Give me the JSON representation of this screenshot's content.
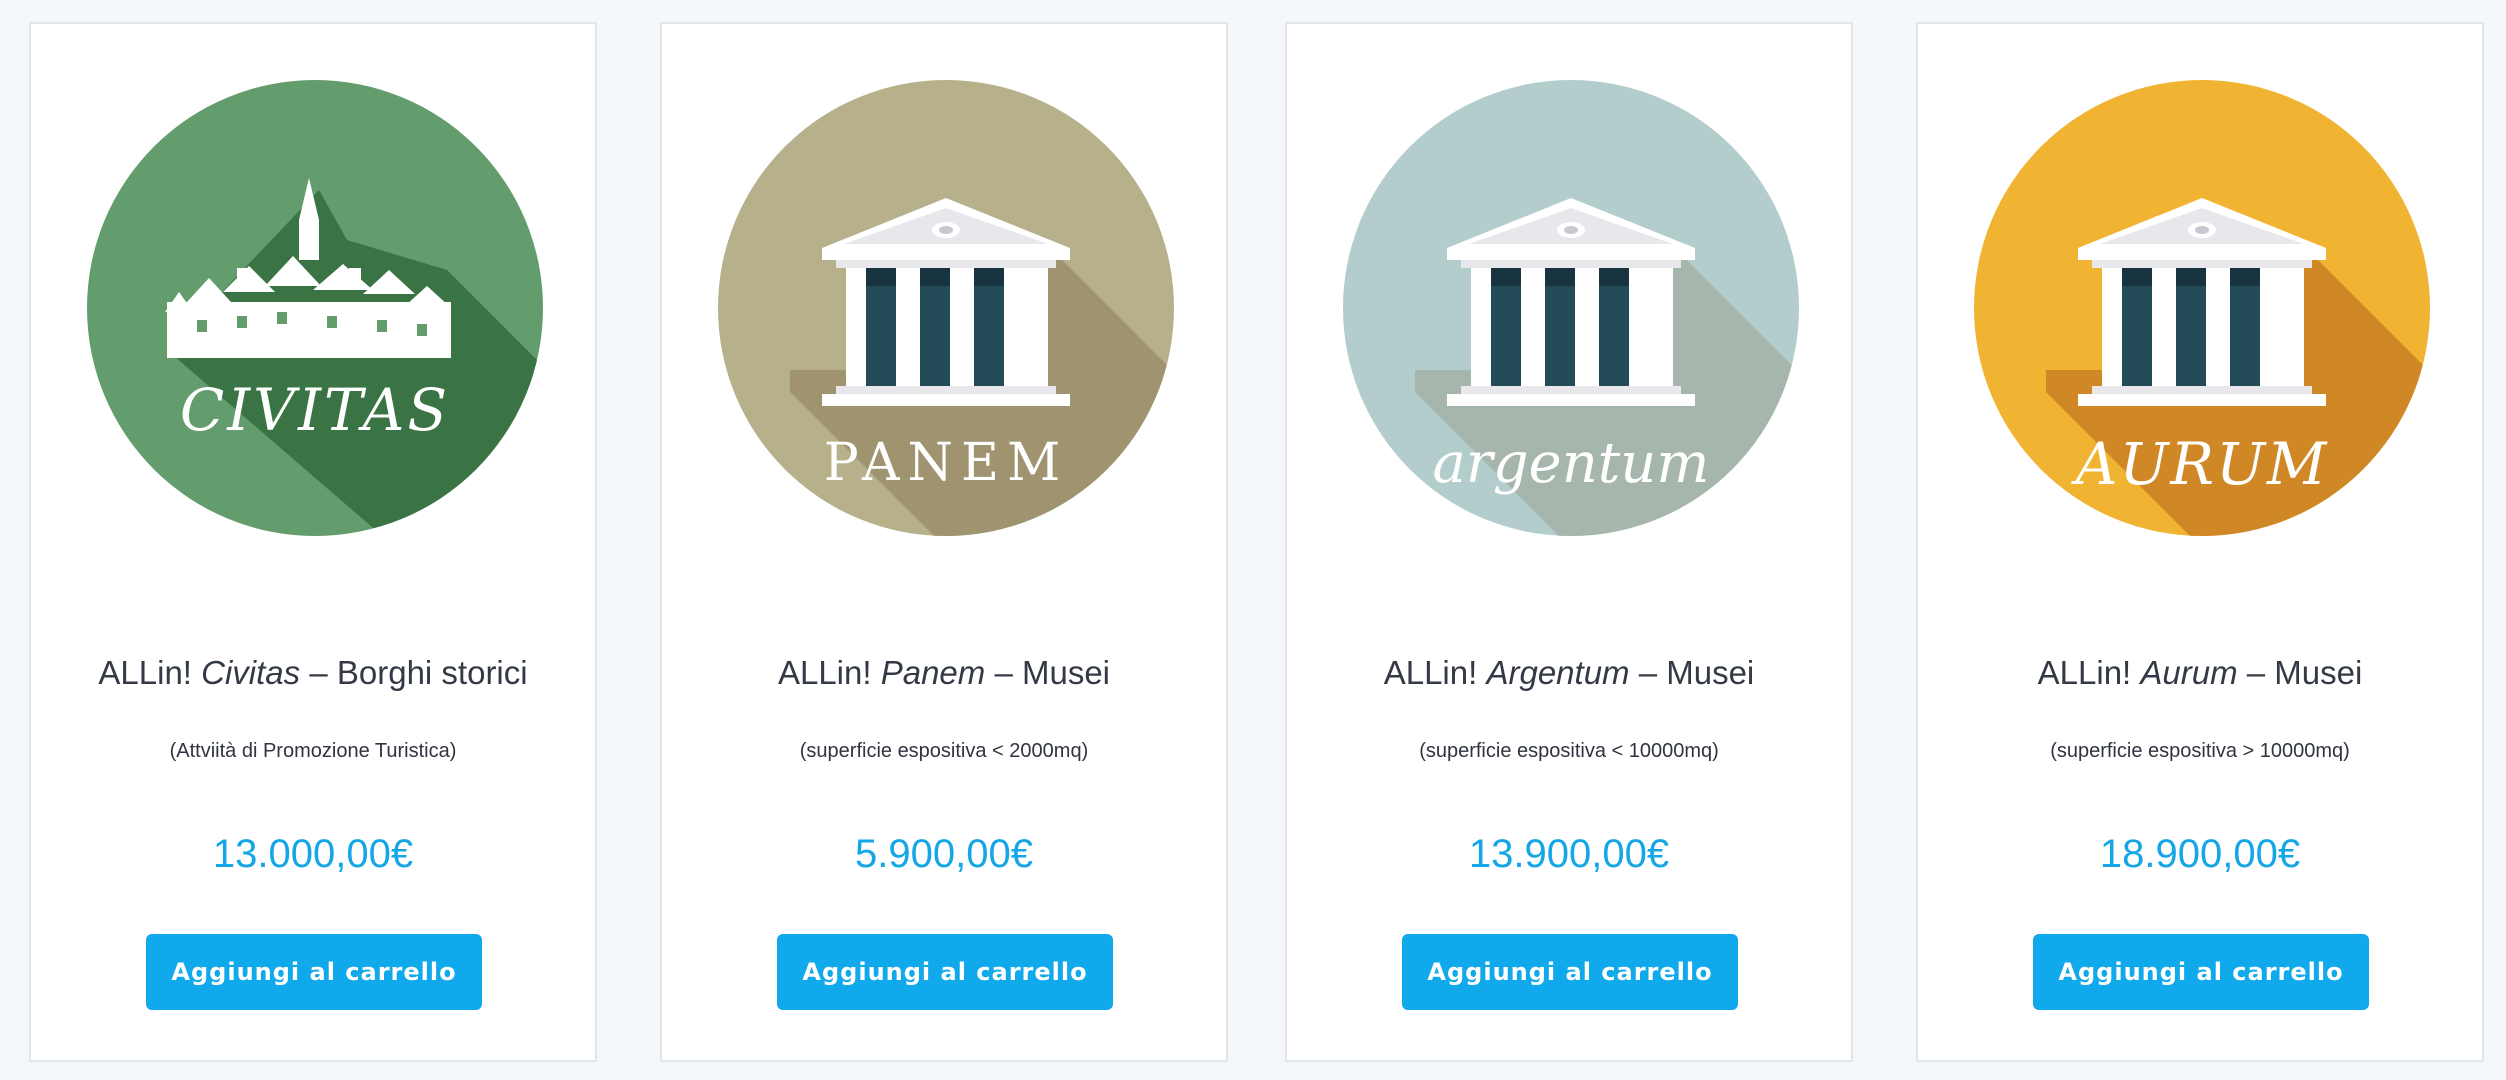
{
  "products": [
    {
      "logo_icon": "village-icon",
      "logo_text": "CIVITAS",
      "color_main": "#649d6d",
      "color_shadow": "#3b7444",
      "title_prefix": "ALLin!",
      "title_name": "Civitas",
      "title_suffix": "– Borghi storici",
      "subtitle": "(Attviità di Promozione Turistica)",
      "price": "13.000,00€",
      "button_label": "Aggiungi al carrello"
    },
    {
      "logo_icon": "museum-icon",
      "logo_text": "PANEM",
      "color_main": "#b6b18b",
      "color_shadow": "#a09370",
      "title_prefix": "ALLin!",
      "title_name": "Panem",
      "title_suffix": "– Musei",
      "subtitle": "(superficie espositiva < 2000mq)",
      "price": "5.900,00€",
      "button_label": "Aggiungi al carrello"
    },
    {
      "logo_icon": "museum-icon",
      "logo_text": "argentum",
      "color_main": "#b3cccc",
      "color_shadow": "#a6b6ac",
      "title_prefix": "ALLin!",
      "title_name": "Argentum",
      "title_suffix": "– Musei",
      "subtitle": "(superficie espositiva < 10000mq)",
      "price": "13.900,00€",
      "button_label": "Aggiungi al carrello"
    },
    {
      "logo_icon": "museum-icon",
      "logo_text": "AURUM",
      "color_main": "#f1b432",
      "color_shadow": "#d08827",
      "title_prefix": "ALLin!",
      "title_name": "Aurum",
      "title_suffix": "– Musei",
      "subtitle": "(superficie espositiva > 10000mq)",
      "price": "18.900,00€",
      "button_label": "Aggiungi al carrello"
    }
  ]
}
